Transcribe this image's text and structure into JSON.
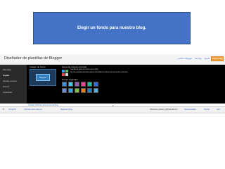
{
  "banner": {
    "text": "Elegir un fondo para nuestro blog."
  },
  "designer": {
    "title": "Diseñador de plantillas de Blogger",
    "links": [
      "« Volver a Blogger",
      "Ver blog",
      "Ayuda"
    ],
    "apply": "Aplicar al blog",
    "sidebar": [
      "Plantillas",
      "Fondo",
      "Ajustar anchos",
      "Diseño",
      "Avanzado"
    ],
    "section_bg": "Imagen de fondo",
    "thumb": "Ninguno",
    "section_colors": "Gama de colores principal",
    "color_desc_1": "Cambiar la gama de colores de tu blog.",
    "color_desc_2": "Ve a la pestaña Avanzado para personalizar los colores de elementos concretos.",
    "section_themes": "Temas sugeridos",
    "footer_link": "Ocultar / Mostrar vista previa del blog",
    "colors": {
      "swatches": [
        "#29a9e0",
        "#3fbf5f",
        "#e04a4a",
        "#d9d9d9"
      ],
      "themes": [
        "#3b8fd6",
        "#4cc3e8",
        "#9b59b6",
        "#e84393",
        "#1abc9c",
        "#2d6cdf",
        "#6c8cd5",
        "#35a3e0",
        "#7dc242",
        "#e67e22",
        "#2980b9",
        "#5dade2"
      ]
    }
  },
  "bottombar": {
    "items": [
      "Compartir",
      "Informar sobre mal uso",
      "Siguiente blog»"
    ],
    "right": [
      "dizamoma_donsin_jp@hotmail.com",
      "Nueva entrada",
      "Diseño",
      "Salir"
    ]
  }
}
